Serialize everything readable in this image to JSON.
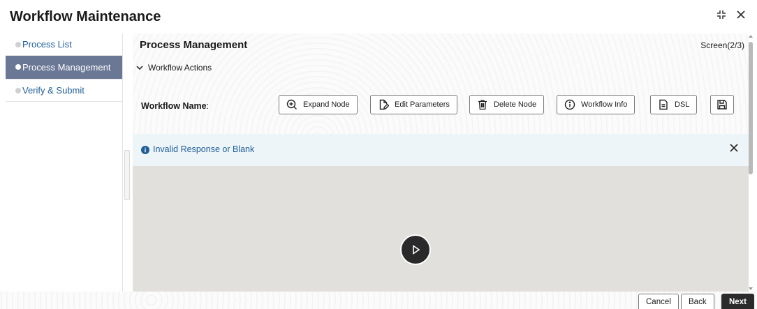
{
  "header": {
    "title": "Workflow Maintenance",
    "icons": {
      "collapse": "collapse-icon",
      "close": "close-icon"
    }
  },
  "sidebar": {
    "items": [
      {
        "label": "Process List",
        "active": false
      },
      {
        "label": "Process Management",
        "active": true
      },
      {
        "label": "Verify & Submit",
        "active": false
      }
    ]
  },
  "main": {
    "title": "Process Management",
    "screen_indicator": "Screen(2/3)",
    "workflow_actions_label": "Workflow Actions",
    "workflow_name_label": "Workflow Name",
    "workflow_name_colon": ":",
    "toolbar": {
      "expand_node": "Expand Node",
      "edit_parameters": "Edit Parameters",
      "delete_node": "Delete Node",
      "workflow_info": "Workflow Info",
      "dsl": "DSL"
    },
    "alert": {
      "message": "Invalid Response or Blank"
    }
  },
  "footer": {
    "cancel": "Cancel",
    "back": "Back",
    "next": "Next"
  },
  "colors": {
    "sidebar_active_bg": "#6a7795",
    "link_blue": "#1f5e99",
    "alert_bg": "#eef5f8",
    "canvas_bg": "#e2e0dd",
    "primary_button": "#2b2b2b"
  }
}
